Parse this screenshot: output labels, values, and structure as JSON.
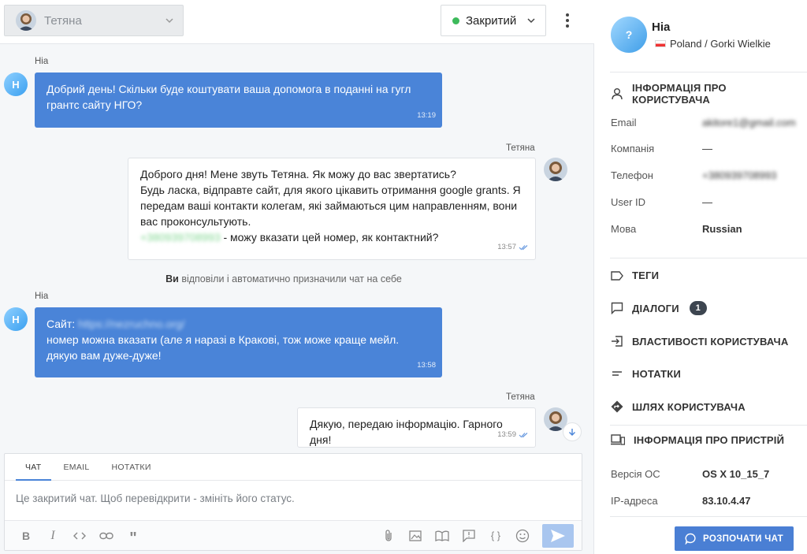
{
  "topbar": {
    "agent_name": "Тетяна",
    "status_label": "Закритий",
    "status_color": "#3dba5b"
  },
  "messages": [
    {
      "sender": "Ніа",
      "avatar_letter": "Н",
      "text": "Добрий день! Скільки буде коштувати ваша допомога в поданні на гугл грантс сайту НГО?",
      "time": "13:19"
    },
    {
      "sender": "Тетяна",
      "lines": [
        "Доброго дня! Мене звуть Тетяна. Як можу до вас звертатись?",
        "Будь ласка, відправте сайт, для якого цікавить отримання google grants. Я передам ваші контакти колегам, які займаються цим направленням, вони вас проконсультують."
      ],
      "phone_blur": "+380939708993",
      "phone_suffix": " - можу вказати цей номер, як контактний?",
      "time": "13:57"
    },
    {
      "sender": "Ніа",
      "avatar_letter": "Н",
      "prefix": "Сайт: ",
      "link_blur": "https://nezruchno.org/",
      "text": "номер можна вказати (але я наразі в Кракові, тож може краще мейл. дякую вам дуже-дуже!",
      "time": "13:58"
    },
    {
      "sender": "Тетяна",
      "text": "Дякую, передаю інформацію. Гарного дня!",
      "time": "13:59"
    }
  ],
  "system_note": {
    "bold": "Ви",
    "text": " відповіли і автоматично призначили чат на себе"
  },
  "composer": {
    "tabs": [
      "ЧАТ",
      "EMAIL",
      "НОТАТКИ"
    ],
    "placeholder": "Це закритий чат. Щоб перевідкрити - змініть його статус."
  },
  "user": {
    "avatar_letter": "?",
    "name": "Ніа",
    "location": "Poland / Gorki Wielkie"
  },
  "info_section": {
    "title": "ІНФОРМАЦІЯ ПРО КОРИСТУВАЧА",
    "rows": [
      {
        "k": "Email",
        "v": "akitore1@gmail.com"
      },
      {
        "k": "Компанія",
        "v": "—"
      },
      {
        "k": "Телефон",
        "v": "+380939708993"
      },
      {
        "k": "User ID",
        "v": "—"
      },
      {
        "k": "Мова",
        "v": "Russian"
      }
    ]
  },
  "sections": {
    "tags": "ТЕГИ",
    "dialogs": "ДІАЛОГИ",
    "dialogs_count": "1",
    "properties": "ВЛАСТИВОСТІ КОРИСТУВАЧА",
    "notes": "НОТАТКИ",
    "path": "ШЛЯХ КОРИСТУВАЧА",
    "device": "ІНФОРМАЦІЯ ПРО ПРИСТРІЙ"
  },
  "device_rows": [
    {
      "k": "Версія ОС",
      "v": "OS X 10_15_7"
    },
    {
      "k": "IP-адреса",
      "v": "83.10.4.47"
    }
  ],
  "start_chat_label": "РОЗПОЧАТИ ЧАТ",
  "colors": {
    "accent": "#4a84d8",
    "bubble_in": "#4a84d8",
    "closed_dot": "#3dba5b"
  }
}
